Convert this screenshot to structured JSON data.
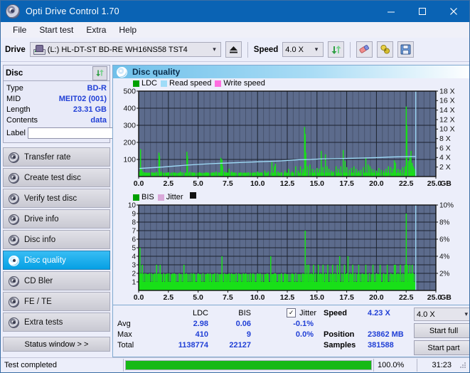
{
  "window": {
    "title": "Opti Drive Control 1.70",
    "icon": "disc-icon",
    "minimize": "minimize-icon",
    "maximize": "maximize-icon",
    "close": "close-icon"
  },
  "menu": {
    "items": [
      {
        "label": "File"
      },
      {
        "label": "Start test"
      },
      {
        "label": "Extra"
      },
      {
        "label": "Help"
      }
    ]
  },
  "toolbar": {
    "drive_label": "Drive",
    "drive_value": "(L:)  HL-DT-ST BD-RE  WH16NS58 TST4",
    "drive_icon": "drive-icon",
    "eject_icon": "eject-icon",
    "speed_label": "Speed",
    "speed_value": "4.0 X",
    "refresh_icon": "refresh-icon",
    "eraser_icon": "eraser-icon",
    "plug_icon": "plug-icon",
    "save_icon": "save-icon"
  },
  "disc_panel": {
    "title": "Disc",
    "refresh_icon": "refresh-icon",
    "rows": [
      {
        "key": "Type",
        "value": "BD-R"
      },
      {
        "key": "MID",
        "value": "MEIT02 (001)"
      },
      {
        "key": "Length",
        "value": "23.31 GB"
      },
      {
        "key": "Contents",
        "value": "data"
      }
    ],
    "label_key": "Label",
    "label_value": "",
    "label_placeholder": "",
    "label_button_icon": "disc-icon"
  },
  "sidebar": {
    "items": [
      {
        "label": "Transfer rate",
        "icon": "disc-speed-icon",
        "selected": false
      },
      {
        "label": "Create test disc",
        "icon": "disc-write-icon",
        "selected": false
      },
      {
        "label": "Verify test disc",
        "icon": "disc-verify-icon",
        "selected": false
      },
      {
        "label": "Drive info",
        "icon": "drive-info-icon",
        "selected": false
      },
      {
        "label": "Disc info",
        "icon": "disc-info-icon",
        "selected": false
      },
      {
        "label": "Disc quality",
        "icon": "disc-quality-icon",
        "selected": true
      },
      {
        "label": "CD Bler",
        "icon": "cd-bler-icon",
        "selected": false
      },
      {
        "label": "FE / TE",
        "icon": "fe-te-icon",
        "selected": false
      },
      {
        "label": "Extra tests",
        "icon": "extra-tests-icon",
        "selected": false
      }
    ],
    "status_window_label": "Status window > >"
  },
  "panel": {
    "title": "Disc quality",
    "icon": "disc-quality-icon"
  },
  "stats": {
    "col_headers": [
      "LDC",
      "BIS"
    ],
    "row_labels": [
      "Avg",
      "Max",
      "Total"
    ],
    "ldc": {
      "avg": "2.98",
      "max": "410",
      "total": "1138774"
    },
    "bis": {
      "avg": "0.06",
      "max": "9",
      "total": "22127"
    },
    "jitter": {
      "checkbox_label": "Jitter",
      "checked": true,
      "check_glyph": "✓",
      "avg": "-0.1%",
      "max": "0.0%"
    },
    "speed_label": "Speed",
    "speed_value": "4.23 X",
    "position_label": "Position",
    "position_value": "23862 MB",
    "samples_label": "Samples",
    "samples_value": "381588",
    "speed_select_value": "4.0 X",
    "start_full_label": "Start full",
    "start_part_label": "Start part"
  },
  "statusbar": {
    "message": "Test completed",
    "progress_percent": "100.0%",
    "progress_value": 100,
    "elapsed": "31:23",
    "grip_icon": "resize-grip-icon"
  },
  "colors": {
    "accent_blue": "#0a63b4",
    "value_blue": "#2140d6",
    "ldc_green": "#00a000",
    "bar_green": "#18e018",
    "read_speed": "#9fdcf8",
    "write_speed": "#ff6ee0",
    "jitter_pink": "#d9a8d9",
    "plot_bg": "#5c6b8c",
    "grid": "#27303f",
    "progress_green": "#16b916"
  },
  "chart_data": [
    {
      "type": "line",
      "name": "disc-quality-ldc-chart",
      "title": "",
      "legend": [
        {
          "label": "LDC",
          "color": "#00a000"
        },
        {
          "label": "Read speed",
          "color": "#9fdcf8"
        },
        {
          "label": "Write speed",
          "color": "#ff6ee0"
        }
      ],
      "legend_position": "top-left",
      "xlabel": "GB",
      "xlim": [
        0,
        25
      ],
      "xticks": [
        "0.0",
        "2.5",
        "5.0",
        "7.5",
        "10.0",
        "12.5",
        "15.0",
        "17.5",
        "20.0",
        "22.5",
        "25.0"
      ],
      "ylabel_left": "LDC",
      "ylim": [
        0,
        500
      ],
      "yticks": [
        100,
        200,
        300,
        400,
        500
      ],
      "ylabel_right": "Speed",
      "ylim_right": [
        0,
        18
      ],
      "yticks_right": [
        "2 X",
        "4 X",
        "6 X",
        "8 X",
        "10 X",
        "12 X",
        "14 X",
        "16 X",
        "18 X"
      ],
      "grid": true,
      "data_end_x": 23.31,
      "series": [
        {
          "name": "LDC",
          "color": "#18e018",
          "type": "impulse",
          "x": [
            0.05,
            0.15,
            0.25,
            0.35,
            0.5,
            0.7,
            0.9,
            1.1,
            1.3,
            1.5,
            1.7,
            1.75,
            1.9,
            2.1,
            2.3,
            2.5,
            2.7,
            2.9,
            3.1,
            3.3,
            3.5,
            3.7,
            3.9,
            4.05,
            4.1,
            4.3,
            4.5,
            4.7,
            4.9,
            5.1,
            5.3,
            5.5,
            5.7,
            5.9,
            6.1,
            6.3,
            6.5,
            6.7,
            6.9,
            7.0,
            7.05,
            7.2,
            7.4,
            7.6,
            7.8,
            8.0,
            8.2,
            8.4,
            8.6,
            8.8,
            9.0,
            9.2,
            9.4,
            9.6,
            9.8,
            10.0,
            10.3,
            10.6,
            10.9,
            11.2,
            11.4,
            11.5,
            11.7,
            12.0,
            12.3,
            12.6,
            12.9,
            13.2,
            13.4,
            13.6,
            13.8,
            13.95,
            14.0,
            14.05,
            14.2,
            14.4,
            14.6,
            14.8,
            15.0,
            15.2,
            15.35,
            15.5,
            15.7,
            15.85,
            16.0,
            16.2,
            16.4,
            16.6,
            16.8,
            17.0,
            17.2,
            17.35,
            17.5,
            17.7,
            17.9,
            18.1,
            18.3,
            18.5,
            18.7,
            18.9,
            19.1,
            19.3,
            19.45,
            19.6,
            19.8,
            20.0,
            20.2,
            20.4,
            20.6,
            20.8,
            21.0,
            21.2,
            21.4,
            21.5,
            21.6,
            21.8,
            22.0,
            22.2,
            22.4,
            22.5,
            22.55,
            22.7,
            22.8,
            22.9,
            23.0,
            23.1,
            23.2,
            23.3
          ],
          "y": [
            30,
            160,
            45,
            30,
            25,
            20,
            22,
            25,
            20,
            28,
            140,
            120,
            30,
            22,
            20,
            25,
            20,
            25,
            22,
            20,
            30,
            25,
            22,
            145,
            120,
            30,
            25,
            20,
            22,
            25,
            20,
            22,
            25,
            20,
            22,
            25,
            30,
            25,
            110,
            100,
            60,
            30,
            25,
            45,
            30,
            25,
            22,
            20,
            25,
            22,
            20,
            25,
            22,
            20,
            25,
            30,
            25,
            35,
            30,
            85,
            60,
            75,
            30,
            25,
            35,
            45,
            30,
            60,
            35,
            60,
            45,
            290,
            250,
            140,
            60,
            70,
            45,
            40,
            50,
            45,
            150,
            55,
            130,
            60,
            45,
            35,
            30,
            60,
            45,
            60,
            155,
            90,
            55,
            40,
            50,
            60,
            45,
            35,
            40,
            55,
            110,
            70,
            60,
            45,
            40,
            35,
            50,
            40,
            35,
            45,
            60,
            55,
            45,
            95,
            80,
            45,
            40,
            55,
            60,
            410,
            300,
            90,
            120,
            150,
            80,
            60,
            45,
            35
          ]
        },
        {
          "name": "Read speed",
          "color": "#9fdcf8",
          "type": "line",
          "x": [
            0.0,
            1.0,
            2.0,
            3.0,
            4.0,
            5.0,
            6.0,
            7.0,
            8.0,
            9.0,
            10.0,
            11.0,
            12.0,
            12.6,
            13.5,
            14.5,
            15.3,
            16.2,
            17.2,
            18.0,
            18.8,
            19.5,
            20.3,
            21.0,
            21.8,
            22.6,
            23.3
          ],
          "y": [
            1.7,
            1.85,
            2.0,
            2.2,
            2.4,
            2.55,
            2.7,
            2.8,
            2.9,
            3.0,
            3.1,
            3.2,
            3.3,
            3.4,
            3.55,
            3.6,
            3.7,
            3.75,
            3.8,
            3.85,
            3.9,
            3.95,
            4.0,
            4.1,
            4.15,
            4.2,
            4.23
          ],
          "unit": "X",
          "axis": "right"
        },
        {
          "name": "Write speed",
          "color": "#ff6ee0",
          "type": "line",
          "x": [],
          "y": [],
          "axis": "right"
        }
      ]
    },
    {
      "type": "bar",
      "name": "disc-quality-bis-chart",
      "title": "",
      "legend": [
        {
          "label": "BIS",
          "color": "#00a000"
        },
        {
          "label": "Jitter",
          "color": "#d9a8d9"
        }
      ],
      "legend_position": "top-left",
      "xlabel": "GB",
      "xlim": [
        0,
        25
      ],
      "xticks": [
        "0.0",
        "2.5",
        "5.0",
        "7.5",
        "10.0",
        "12.5",
        "15.0",
        "17.5",
        "20.0",
        "22.5",
        "25.0"
      ],
      "ylabel_left": "BIS",
      "ylim": [
        0,
        10
      ],
      "yticks": [
        1,
        2,
        3,
        4,
        5,
        6,
        7,
        8,
        9,
        10
      ],
      "ylabel_right": "Jitter",
      "ylim_right": [
        0,
        10
      ],
      "yticks_right": [
        "2%",
        "4%",
        "6%",
        "8%",
        "10%"
      ],
      "grid": true,
      "data_end_x": 23.31,
      "series": [
        {
          "name": "BIS",
          "color": "#18e018",
          "type": "impulse",
          "baseline": 1,
          "x": [
            0.1,
            0.2,
            0.3,
            0.45,
            0.6,
            0.75,
            0.9,
            1.05,
            1.2,
            1.35,
            1.5,
            1.65,
            1.8,
            1.95,
            2.1,
            2.25,
            2.4,
            2.55,
            2.7,
            2.85,
            3.0,
            3.2,
            3.4,
            3.6,
            3.8,
            4.0,
            4.2,
            4.4,
            4.6,
            4.8,
            5.0,
            5.2,
            5.4,
            5.6,
            5.8,
            6.0,
            6.2,
            6.4,
            6.6,
            6.8,
            7.0,
            7.2,
            7.4,
            7.6,
            7.8,
            8.0,
            8.2,
            8.4,
            8.6,
            8.8,
            9.0,
            9.2,
            9.4,
            9.6,
            9.8,
            10.0,
            10.2,
            10.5,
            10.8,
            11.1,
            11.4,
            11.5,
            11.7,
            12.0,
            12.3,
            12.6,
            12.9,
            13.2,
            13.5,
            13.8,
            14.0,
            14.15,
            14.3,
            14.5,
            14.7,
            14.9,
            15.1,
            15.3,
            15.5,
            15.7,
            15.9,
            16.1,
            16.3,
            16.5,
            16.7,
            16.9,
            17.1,
            17.3,
            17.5,
            17.6,
            17.8,
            18.0,
            18.2,
            18.5,
            18.8,
            19.1,
            19.4,
            19.7,
            20.0,
            20.3,
            20.6,
            20.9,
            21.2,
            21.5,
            21.6,
            21.8,
            22.0,
            22.2,
            22.4,
            22.5,
            22.6,
            22.7,
            22.8,
            22.9,
            23.0,
            23.1,
            23.2,
            23.3
          ],
          "y": [
            5,
            2,
            3,
            2,
            2,
            1,
            2,
            2,
            1,
            2,
            3,
            2,
            3,
            1,
            2,
            1,
            2,
            2,
            1,
            2,
            2,
            1,
            2,
            1,
            3,
            2,
            1,
            2,
            2,
            1,
            2,
            1,
            2,
            1,
            2,
            2,
            1,
            2,
            2,
            1,
            4,
            2,
            1,
            2,
            2,
            1,
            2,
            2,
            1,
            2,
            2,
            1,
            2,
            2,
            1,
            2,
            2,
            1,
            2,
            4,
            2,
            2,
            1,
            2,
            2,
            1,
            2,
            2,
            1,
            2,
            7,
            3,
            3,
            2,
            3,
            2,
            3,
            2,
            3,
            2,
            3,
            2,
            3,
            2,
            3,
            4,
            2,
            3,
            2,
            4,
            2,
            3,
            2,
            3,
            2,
            3,
            2,
            3,
            2,
            3,
            2,
            3,
            2,
            3,
            3,
            2,
            3,
            2,
            3,
            9,
            3,
            2,
            3,
            2,
            3,
            2,
            1,
            1
          ]
        },
        {
          "name": "Jitter",
          "color": "#d9a8d9",
          "type": "line",
          "x": [],
          "y": [],
          "axis": "right"
        }
      ]
    }
  ]
}
